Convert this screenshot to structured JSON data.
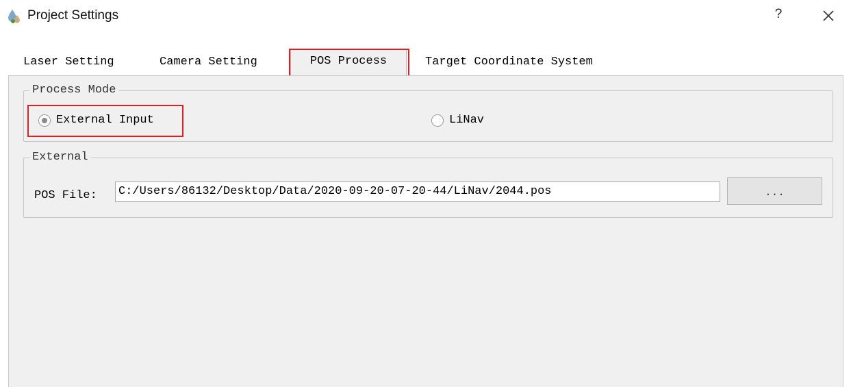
{
  "window": {
    "title": "Project Settings",
    "help_label": "?",
    "icons": {
      "app": "water-drop-icon",
      "close": "close-icon"
    }
  },
  "tabs": [
    {
      "label": "Laser Setting",
      "active": false
    },
    {
      "label": "Camera Setting",
      "active": false
    },
    {
      "label": "POS Process",
      "active": true
    },
    {
      "label": "Target Coordinate System",
      "active": false
    }
  ],
  "process_mode": {
    "title": "Process Mode",
    "options": [
      {
        "label": "External Input",
        "selected": true
      },
      {
        "label": "LiNav",
        "selected": false
      }
    ]
  },
  "external": {
    "title": "External",
    "pos_file_label": "POS File:",
    "pos_file_value": "C:/Users/86132/Desktop/Data/2020-09-20-07-20-44/LiNav/2044.pos",
    "browse_label": "..."
  },
  "colors": {
    "highlight": "#e02020",
    "panel_bg": "#f0f0f0"
  }
}
